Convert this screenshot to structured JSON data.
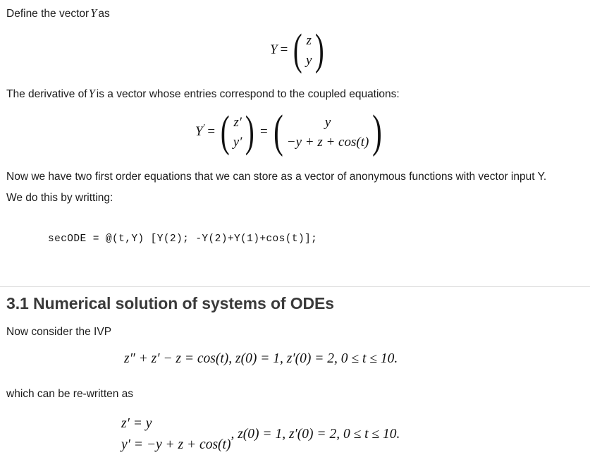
{
  "document": {
    "background_color": "#ffffff",
    "text_color": "#1c1c1c",
    "heading_color": "#3a3a3a",
    "divider_color": "#dcdcdc"
  },
  "paragraphs": {
    "intro_before_Y": "Define the vector",
    "intro_var": "Y",
    "intro_after_Y": "as",
    "derivative_before": "The derivative of",
    "derivative_var": "Y",
    "derivative_after": "is a vector whose entries correspond to the coupled equations:",
    "two_first_order": "Now we have two first order equations that we can store as a vector of anonymous functions with vector input Y. We do this by writting:",
    "now_consider": "Now consider the IVP",
    "rewritten": "which can be re-written as"
  },
  "equations": {
    "vector_Y": {
      "lhs": "Y",
      "equals": "=",
      "entries": [
        "z",
        "y"
      ]
    },
    "derivative_Y": {
      "lhs": "Y",
      "lhs_prime": "′",
      "equals_1": "=",
      "entries_1": [
        "z′",
        "y′"
      ],
      "equals_2": "=",
      "entries_2_top": "y",
      "entries_2_bottom": "−y + z + cos(t)"
    },
    "ivp": {
      "text": "z″ + z′ − z = cos(t), z(0) = 1, z′(0) = 2, 0 ≤ t ≤ 10.",
      "line1": "z″ + z′ − z = cos(t)",
      "conditions": ", z(0) = 1, z′(0) = 2, 0 ≤ t ≤ 10."
    },
    "system": {
      "line1": "z′ = y",
      "line2": "y′ = −y + z + cos(t)",
      "conditions": ", z(0) = 1, z′(0) = 2, 0 ≤ t ≤ 10."
    }
  },
  "code_block": {
    "language": "matlab",
    "line": "secODE = @(t,Y) [Y(2); -Y(2)+Y(1)+cos(t)];"
  },
  "section": {
    "number": "3.1",
    "heading": "3.1 Numerical solution of systems of ODEs"
  }
}
